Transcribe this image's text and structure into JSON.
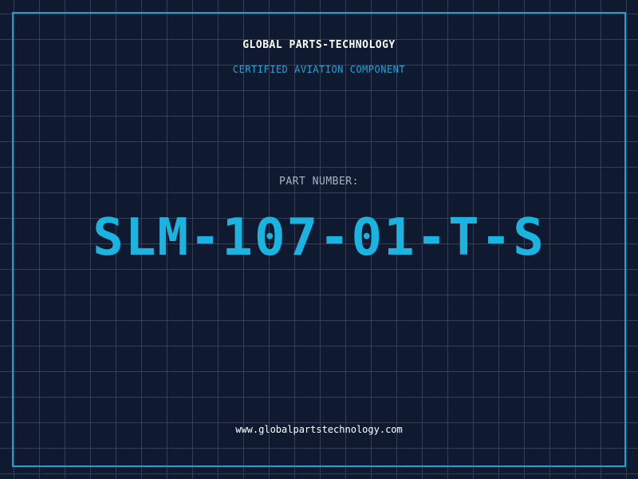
{
  "header": {
    "company": "GLOBAL PARTS-TECHNOLOGY",
    "tagline": "CERTIFIED AVIATION COMPONENT"
  },
  "part": {
    "label": "PART NUMBER:",
    "number": "SLM-107-01-T-S"
  },
  "footer": {
    "website": "www.globalpartstechnology.com"
  },
  "colors": {
    "background": "#0f1a30",
    "grid": "#286e8c",
    "accent": "#1bb3e0",
    "frame": "#1a9fd0",
    "label": "#a8b4c4"
  }
}
